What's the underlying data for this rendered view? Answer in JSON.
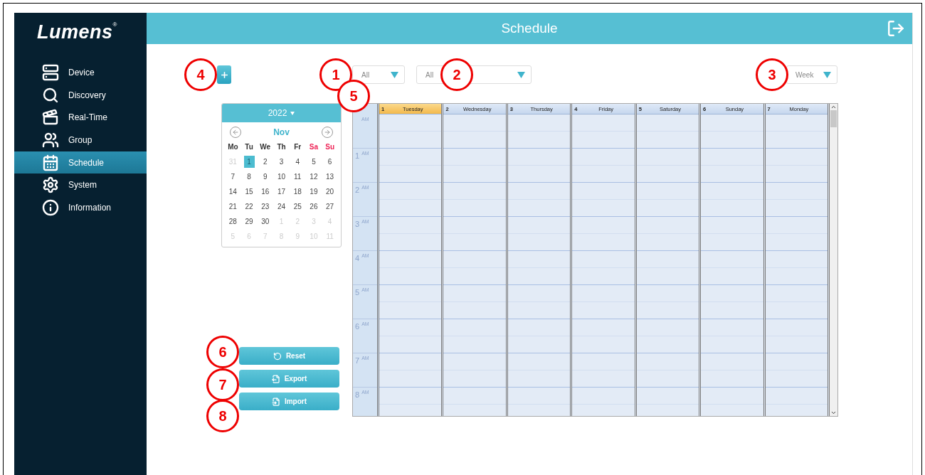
{
  "sidebar": {
    "logo": "Lumens",
    "logo_mark": "®",
    "items": [
      {
        "label": "Device",
        "selected": false
      },
      {
        "label": "Discovery",
        "selected": false
      },
      {
        "label": "Real-Time",
        "selected": false
      },
      {
        "label": "Group",
        "selected": false
      },
      {
        "label": "Schedule",
        "selected": true
      },
      {
        "label": "System",
        "selected": false
      },
      {
        "label": "Information",
        "selected": false
      }
    ]
  },
  "header": {
    "title": "Schedule"
  },
  "toolbar": {
    "add_callout": "4",
    "filters": [
      {
        "value": "All",
        "callout": "1"
      },
      {
        "value": "All",
        "callout": "2"
      }
    ],
    "view": {
      "value": "Week",
      "callout": "3"
    }
  },
  "mini_calendar": {
    "year": "2022",
    "month": "Nov",
    "weekdays": [
      {
        "label": "Mo",
        "weekend": false
      },
      {
        "label": "Tu",
        "weekend": false
      },
      {
        "label": "We",
        "weekend": false
      },
      {
        "label": "Th",
        "weekend": false
      },
      {
        "label": "Fr",
        "weekend": false
      },
      {
        "label": "Sa",
        "weekend": true
      },
      {
        "label": "Su",
        "weekend": true
      }
    ],
    "days": [
      {
        "label": "31",
        "muted": true,
        "selected": false
      },
      {
        "label": "1",
        "muted": false,
        "selected": true
      },
      {
        "label": "2",
        "muted": false,
        "selected": false
      },
      {
        "label": "3",
        "muted": false,
        "selected": false
      },
      {
        "label": "4",
        "muted": false,
        "selected": false
      },
      {
        "label": "5",
        "muted": false,
        "selected": false
      },
      {
        "label": "6",
        "muted": false,
        "selected": false
      },
      {
        "label": "7",
        "muted": false,
        "selected": false
      },
      {
        "label": "8",
        "muted": false,
        "selected": false
      },
      {
        "label": "9",
        "muted": false,
        "selected": false
      },
      {
        "label": "10",
        "muted": false,
        "selected": false
      },
      {
        "label": "11",
        "muted": false,
        "selected": false
      },
      {
        "label": "12",
        "muted": false,
        "selected": false
      },
      {
        "label": "13",
        "muted": false,
        "selected": false
      },
      {
        "label": "14",
        "muted": false,
        "selected": false
      },
      {
        "label": "15",
        "muted": false,
        "selected": false
      },
      {
        "label": "16",
        "muted": false,
        "selected": false
      },
      {
        "label": "17",
        "muted": false,
        "selected": false
      },
      {
        "label": "18",
        "muted": false,
        "selected": false
      },
      {
        "label": "19",
        "muted": false,
        "selected": false
      },
      {
        "label": "20",
        "muted": false,
        "selected": false
      },
      {
        "label": "21",
        "muted": false,
        "selected": false
      },
      {
        "label": "22",
        "muted": false,
        "selected": false
      },
      {
        "label": "23",
        "muted": false,
        "selected": false
      },
      {
        "label": "24",
        "muted": false,
        "selected": false
      },
      {
        "label": "25",
        "muted": false,
        "selected": false
      },
      {
        "label": "26",
        "muted": false,
        "selected": false
      },
      {
        "label": "27",
        "muted": false,
        "selected": false
      },
      {
        "label": "28",
        "muted": false,
        "selected": false
      },
      {
        "label": "29",
        "muted": false,
        "selected": false
      },
      {
        "label": "30",
        "muted": false,
        "selected": false
      },
      {
        "label": "1",
        "muted": true,
        "selected": false
      },
      {
        "label": "2",
        "muted": true,
        "selected": false
      },
      {
        "label": "3",
        "muted": true,
        "selected": false
      },
      {
        "label": "4",
        "muted": true,
        "selected": false
      },
      {
        "label": "5",
        "muted": true,
        "selected": false
      },
      {
        "label": "6",
        "muted": true,
        "selected": false
      },
      {
        "label": "7",
        "muted": true,
        "selected": false
      },
      {
        "label": "8",
        "muted": true,
        "selected": false
      },
      {
        "label": "9",
        "muted": true,
        "selected": false
      },
      {
        "label": "10",
        "muted": true,
        "selected": false
      },
      {
        "label": "11",
        "muted": true,
        "selected": false
      }
    ]
  },
  "actions": [
    {
      "label": "Reset",
      "callout": "6"
    },
    {
      "label": "Export",
      "callout": "7"
    },
    {
      "label": "Import",
      "callout": "8"
    }
  ],
  "week": {
    "callout": "5",
    "days": [
      {
        "number": "1",
        "name": "Tuesday",
        "selected": true
      },
      {
        "number": "2",
        "name": "Wednesday",
        "selected": false
      },
      {
        "number": "3",
        "name": "Thursday",
        "selected": false
      },
      {
        "number": "4",
        "name": "Friday",
        "selected": false
      },
      {
        "number": "5",
        "name": "Saturday",
        "selected": false
      },
      {
        "number": "6",
        "name": "Sunday",
        "selected": false
      },
      {
        "number": "7",
        "name": "Monday",
        "selected": false
      }
    ],
    "time_slots": [
      {
        "suffix": "AM"
      },
      {
        "hour": "1",
        "suffix": "AM"
      },
      {
        "hour": "2",
        "suffix": "AM"
      },
      {
        "hour": "3",
        "suffix": "AM"
      },
      {
        "hour": "4",
        "suffix": "AM"
      },
      {
        "hour": "5",
        "suffix": "AM"
      },
      {
        "hour": "6",
        "suffix": "AM"
      },
      {
        "hour": "7",
        "suffix": "AM"
      },
      {
        "hour": "8",
        "suffix": "AM"
      }
    ]
  }
}
